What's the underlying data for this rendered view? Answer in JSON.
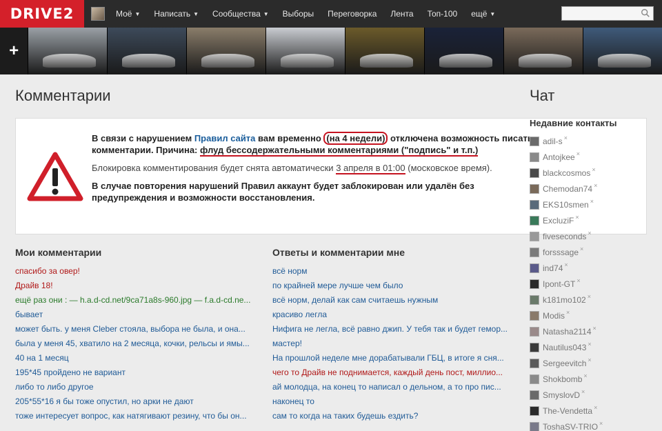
{
  "header": {
    "logo": "DRIVE2",
    "nav": [
      {
        "label": "Моё",
        "caret": true
      },
      {
        "label": "Написать",
        "caret": true
      },
      {
        "label": "Сообщества",
        "caret": true
      },
      {
        "label": "Выборы",
        "caret": false
      },
      {
        "label": "Переговорка",
        "caret": false
      },
      {
        "label": "Лента",
        "caret": false
      },
      {
        "label": "Топ-100",
        "caret": false
      },
      {
        "label": "ещё",
        "caret": true
      }
    ],
    "search_placeholder": ""
  },
  "strip": {
    "add_label": "+",
    "thumbs": [
      "#9aa0a6",
      "#3d4a5a",
      "#8a7d6a",
      "#c9ccd1",
      "#6b5a2a",
      "#1a2238",
      "#7a6a5a",
      "#3f5a7a"
    ]
  },
  "page": {
    "title": "Комментарии",
    "chat_title": "Чат"
  },
  "notice": {
    "p1_a": "В связи с нарушением ",
    "p1_link": "Правил сайта",
    "p1_b": " вам временно ",
    "p1_circled": "(на 4 недели)",
    "p1_c": " отключена возможность писать комментарии. Причина: ",
    "p1_reason": "флуд бессодержательными комментариями (\"подпись\" и т.п.)",
    "p2_a": "Блокировка комментирования будет снята автоматически ",
    "p2_date": "3 апреля в 01:00",
    "p2_b": " (московское время).",
    "p3": "В случае повторения нарушений Правил аккаунт будет заблокирован или удалён без предупреждения и возможности восстановления."
  },
  "my_comments": {
    "title": "Мои комментарии",
    "items": [
      {
        "text": "спасибо за овер!",
        "color": "red"
      },
      {
        "text": "Драйв 18!",
        "color": "red"
      },
      {
        "text": "ещё раз они : — h.a.d-cd.net/9ca71a8s-960.jpg — f.a.d-cd.ne...",
        "color": "green"
      },
      {
        "text": "бывает",
        "color": "blue"
      },
      {
        "text": "может быть. у меня Cleber стояла, выбора не была, и она...",
        "color": "blue"
      },
      {
        "text": "была у меня 45, хватило на 2 месяца, кочки, рельсы и ямы...",
        "color": "blue"
      },
      {
        "text": "40 на 1 месяц",
        "color": "blue"
      },
      {
        "text": "195*45 пройдено не вариант",
        "color": "blue"
      },
      {
        "text": "либо то либо другое",
        "color": "blue"
      },
      {
        "text": "205*55*16 я бы тоже опустил, но арки не дают",
        "color": "blue"
      },
      {
        "text": "тоже интересует вопрос, как натягивают резину, что бы он...",
        "color": "blue"
      }
    ]
  },
  "replies": {
    "title": "Ответы и комментарии мне",
    "items": [
      {
        "text": "всё норм",
        "color": "blue"
      },
      {
        "text": "по крайней мере лучше чем было",
        "color": "blue"
      },
      {
        "text": "всё норм, делай как сам считаешь нужным",
        "color": "blue"
      },
      {
        "text": "красиво легла",
        "color": "blue"
      },
      {
        "text": "Нифига не легла, всё равно джип. У тебя так и будет гемор...",
        "color": "blue"
      },
      {
        "text": "мастер!",
        "color": "blue"
      },
      {
        "text": "На прошлой неделе мне дорабатывали ГБЦ, в итоге я сня...",
        "color": "blue"
      },
      {
        "text": "чего то Драйв не поднимается, каждый день пост, миллио...",
        "color": "red"
      },
      {
        "text": "ай молодца, на конец то написал о дельном, а то про пис...",
        "color": "blue"
      },
      {
        "text": "наконец то",
        "color": "blue"
      },
      {
        "text": "сам то когда на таких будешь ездить?",
        "color": "blue"
      }
    ]
  },
  "contacts": {
    "title": "Недавние контакты",
    "remove_glyph": "×",
    "items": [
      {
        "name": "adil-s",
        "avatar": "#6a6a6a"
      },
      {
        "name": "Antojkee",
        "avatar": "#8a8a8a"
      },
      {
        "name": "blackcosmos",
        "avatar": "#4a4a4a"
      },
      {
        "name": "Chemodan74",
        "avatar": "#7a6a5a"
      },
      {
        "name": "EKS10smen",
        "avatar": "#5a6a7a"
      },
      {
        "name": "ExcluziF",
        "avatar": "#3a7a5a"
      },
      {
        "name": "fiveseconds",
        "avatar": "#9a9a9a"
      },
      {
        "name": "forsssage",
        "avatar": "#7a7a7a"
      },
      {
        "name": "ind74",
        "avatar": "#5a5a8a"
      },
      {
        "name": "Ipont-GT",
        "avatar": "#2a2a2a"
      },
      {
        "name": "k181mo102",
        "avatar": "#6a7a6a"
      },
      {
        "name": "Modis",
        "avatar": "#8a7a6a"
      },
      {
        "name": "Natasha2114",
        "avatar": "#9a8a8a"
      },
      {
        "name": "Nautilus043",
        "avatar": "#3a3a3a"
      },
      {
        "name": "Sergeevitch",
        "avatar": "#5a5a5a"
      },
      {
        "name": "Shokbomb",
        "avatar": "#8a8a8a"
      },
      {
        "name": "SmyslovD",
        "avatar": "#6a6a6a"
      },
      {
        "name": "The-Vendetta",
        "avatar": "#2a2a2a"
      },
      {
        "name": "ToshaSV-TRIO",
        "avatar": "#7a7a8a"
      }
    ]
  }
}
